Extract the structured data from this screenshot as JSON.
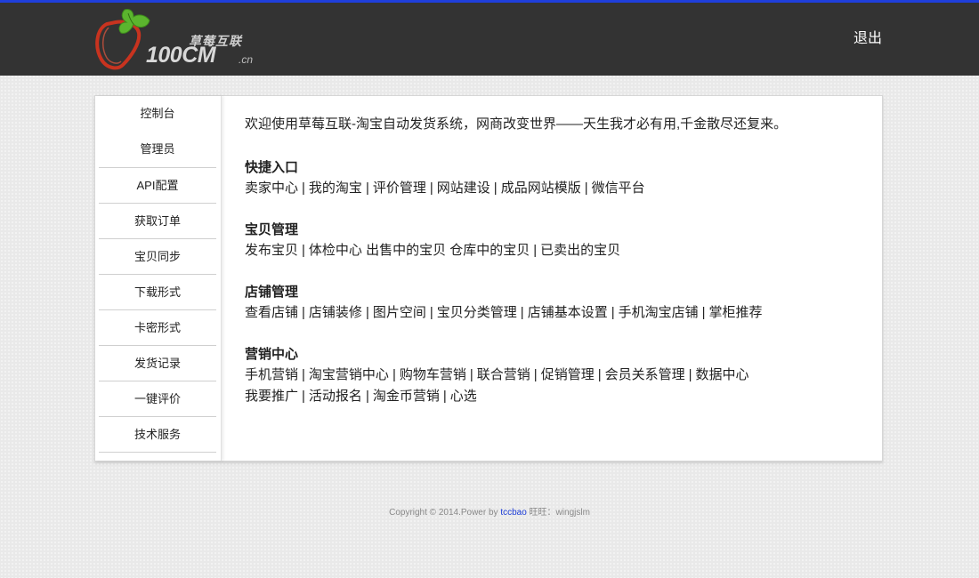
{
  "colors": {
    "accent_bar": "#1f3fdc",
    "header_bg": "#333333",
    "footer_link": "#1a3bd6"
  },
  "header": {
    "logo": {
      "cn": "草莓互联",
      "en": "100CM",
      "suffix": ".cn"
    },
    "logout_label": "退出"
  },
  "sidebar": {
    "items": [
      {
        "label": "控制台"
      },
      {
        "label": "管理员"
      },
      {
        "label": "API配置"
      },
      {
        "label": "获取订单"
      },
      {
        "label": "宝贝同步"
      },
      {
        "label": "下载形式"
      },
      {
        "label": "卡密形式"
      },
      {
        "label": "发货记录"
      },
      {
        "label": "一键评价"
      },
      {
        "label": "技术服务"
      }
    ]
  },
  "main": {
    "welcome": "欢迎使用草莓互联-淘宝自动发货系统，网商改变世界——天生我才必有用,千金散尽还复来。",
    "sections": [
      {
        "title": "快捷入口",
        "rows": [
          [
            "卖家中心",
            "我的淘宝",
            "评价管理",
            "网站建设",
            "成品网站模版",
            "微信平台"
          ]
        ]
      },
      {
        "title": "宝贝管理",
        "rows": [
          [
            "发布宝贝",
            "体检中心 出售中的宝贝 仓库中的宝贝",
            "已卖出的宝贝"
          ]
        ]
      },
      {
        "title": "店铺管理",
        "rows": [
          [
            "查看店铺",
            "店铺装修",
            "图片空间",
            "宝贝分类管理",
            "店铺基本设置",
            "手机淘宝店铺",
            "掌柜推荐"
          ]
        ]
      },
      {
        "title": "营销中心",
        "rows": [
          [
            "手机营销",
            "淘宝营销中心",
            "购物车营销",
            "联合营销",
            "促销管理",
            "会员关系管理",
            "数据中心"
          ],
          [
            "我要推广",
            "活动报名",
            "淘金币营销",
            "心选"
          ]
        ]
      }
    ]
  },
  "footer": {
    "prefix": "Copyright © 2014.Power by ",
    "link": "tccbao",
    "suffix": " 旺旺：wingjslm"
  }
}
